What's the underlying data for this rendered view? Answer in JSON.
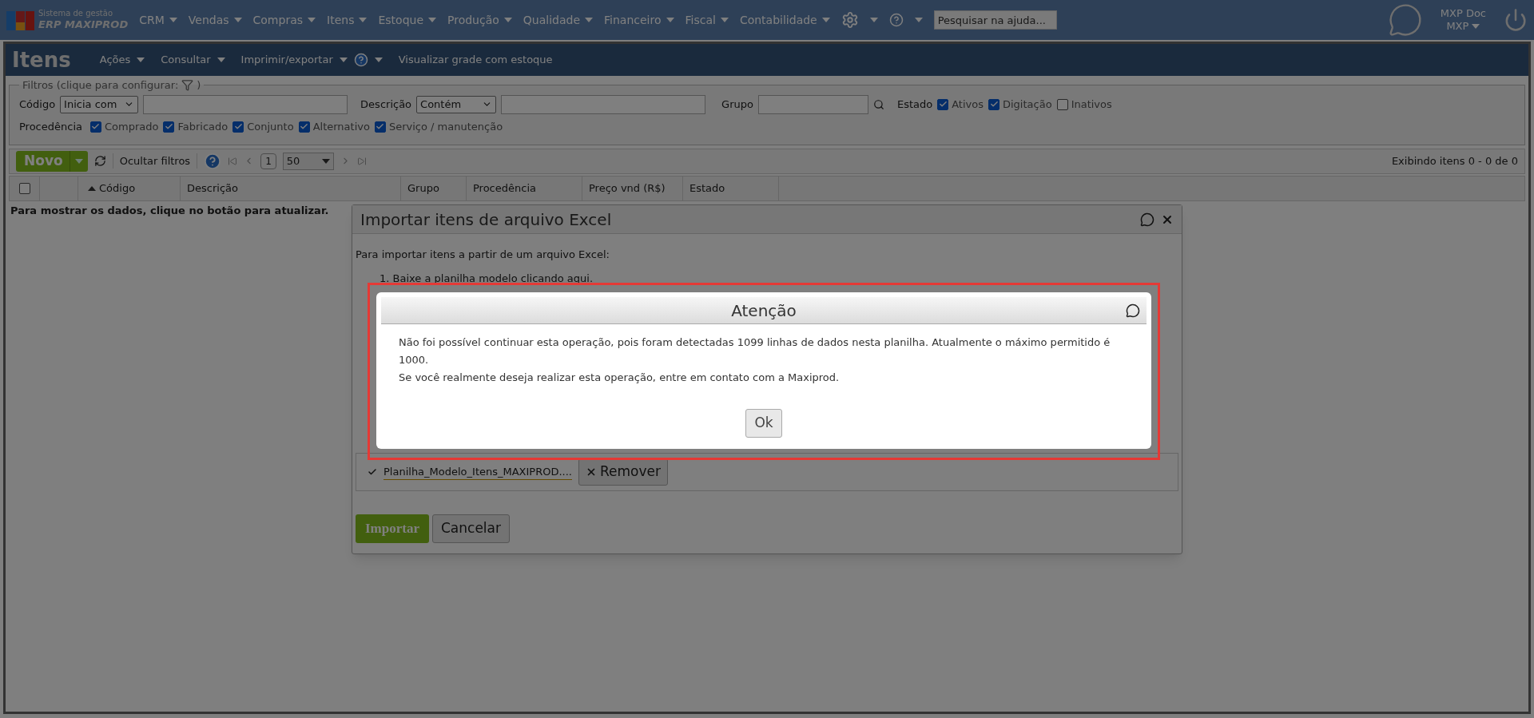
{
  "top_bar": {
    "logo": {
      "line1": "Sistema de gestão",
      "line2": "ERP MAXIPROD"
    },
    "menus": [
      {
        "label": "CRM"
      },
      {
        "label": "Vendas"
      },
      {
        "label": "Compras"
      },
      {
        "label": "Itens"
      },
      {
        "label": "Estoque"
      },
      {
        "label": "Produção"
      },
      {
        "label": "Qualidade"
      },
      {
        "label": "Financeiro"
      },
      {
        "label": "Fiscal"
      },
      {
        "label": "Contabilidade"
      }
    ],
    "help_search": {
      "placeholder": "Pesquisar na ajuda..."
    },
    "user": {
      "name": "MXP Doc",
      "company": "MXP"
    }
  },
  "page_bar": {
    "title": "Itens",
    "menus": [
      {
        "label": "Ações",
        "dropdown": true
      },
      {
        "label": "Consultar",
        "dropdown": true
      },
      {
        "label": "Imprimir/exportar",
        "dropdown": true
      },
      {
        "label": "Visualizar grade com estoque",
        "dropdown": false
      }
    ]
  },
  "filters": {
    "legend": "Filtros (clique para configurar:",
    "legend_close": ")",
    "codigo": {
      "label": "Código",
      "operator": "Inicia com"
    },
    "descricao": {
      "label": "Descrição",
      "operator": "Contém"
    },
    "grupo": {
      "label": "Grupo"
    },
    "estado": {
      "label": "Estado",
      "options": [
        {
          "label": "Ativos",
          "checked": true
        },
        {
          "label": "Digitação",
          "checked": true
        },
        {
          "label": "Inativos",
          "checked": false
        }
      ]
    },
    "procedencia": {
      "label": "Procedência",
      "options": [
        {
          "label": "Comprado",
          "checked": true
        },
        {
          "label": "Fabricado",
          "checked": true
        },
        {
          "label": "Conjunto",
          "checked": true
        },
        {
          "label": "Alternativo",
          "checked": true
        },
        {
          "label": "Serviço / manutenção",
          "checked": true
        }
      ]
    }
  },
  "toolbar": {
    "new_button": "Novo",
    "hide_filters": "Ocultar filtros",
    "page": "1",
    "page_size": "50",
    "status": "Exibindo itens 0 - 0 de 0"
  },
  "table": {
    "select_all": {
      "checked": false
    },
    "columns": [
      {
        "label": "Código",
        "sorted": true
      },
      {
        "label": "Descrição",
        "sorted": false
      },
      {
        "label": "Grupo",
        "sorted": false
      },
      {
        "label": "Procedência",
        "sorted": false
      },
      {
        "label": "Preço vnd (R$)",
        "sorted": false
      },
      {
        "label": "Estado",
        "sorted": false
      }
    ],
    "empty_message": "Para mostrar os dados, clique no botão para atualizar."
  },
  "import_dialog": {
    "title": "Importar itens de arquivo Excel",
    "intro": "Para importar itens a partir de um arquivo Excel:",
    "step1": {
      "text": "1. Baixe a planilha modelo",
      "link": "clicando aqui."
    },
    "file_name": "Planilha_Modelo_Itens_MAXIPROD....",
    "remove_button": "Remover",
    "import_button": "Importar",
    "cancel_button": "Cancelar"
  },
  "alert": {
    "title": "Atenção",
    "lines": [
      "Não foi possível continuar esta operação, pois foram detectadas 1099 linhas de dados nesta planilha. Atualmente o máximo permitido é 1000.",
      "Se você realmente deseja realizar esta operação, entre em contato com a Maxiprod."
    ],
    "ok_button": "Ok"
  }
}
